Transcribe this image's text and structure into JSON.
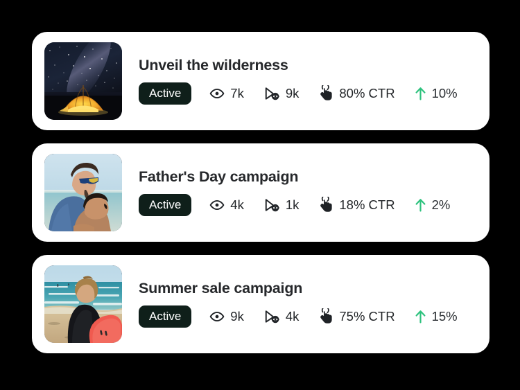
{
  "theme": {
    "background": "#000000",
    "card_background": "#ffffff",
    "title_color": "#26282b",
    "badge_background": "#0f1f1a",
    "badge_text_color": "#ffffff",
    "metric_text_color": "#232629",
    "trend_color": "#2ec27e"
  },
  "cards": [
    {
      "title": "Unveil the wilderness",
      "status": "Active",
      "thumbnail_alt": "night-sky-milky-way-over-glowing-orange-tent",
      "metrics": {
        "impressions_icon": "eye-icon",
        "impressions": "7k",
        "views_icon": "play-views-icon",
        "views": "9k",
        "ctr_icon": "tap-click-icon",
        "ctr": "80% CTR",
        "trend_icon": "arrow-up-icon",
        "trend": "10%"
      }
    },
    {
      "title": "Father's Day campaign",
      "status": "Active",
      "thumbnail_alt": "father-and-son-at-the-beach",
      "metrics": {
        "impressions_icon": "eye-icon",
        "impressions": "4k",
        "views_icon": "play-views-icon",
        "views": "1k",
        "ctr_icon": "tap-click-icon",
        "ctr": "18% CTR",
        "trend_icon": "arrow-up-icon",
        "trend": "2%"
      }
    },
    {
      "title": "Summer sale campaign",
      "status": "Active",
      "thumbnail_alt": "surfer-in-wetsuit-with-red-surfboard-on-beach",
      "metrics": {
        "impressions_icon": "eye-icon",
        "impressions": "9k",
        "views_icon": "play-views-icon",
        "views": "4k",
        "ctr_icon": "tap-click-icon",
        "ctr": "75% CTR",
        "trend_icon": "arrow-up-icon",
        "trend": "15%"
      }
    }
  ]
}
